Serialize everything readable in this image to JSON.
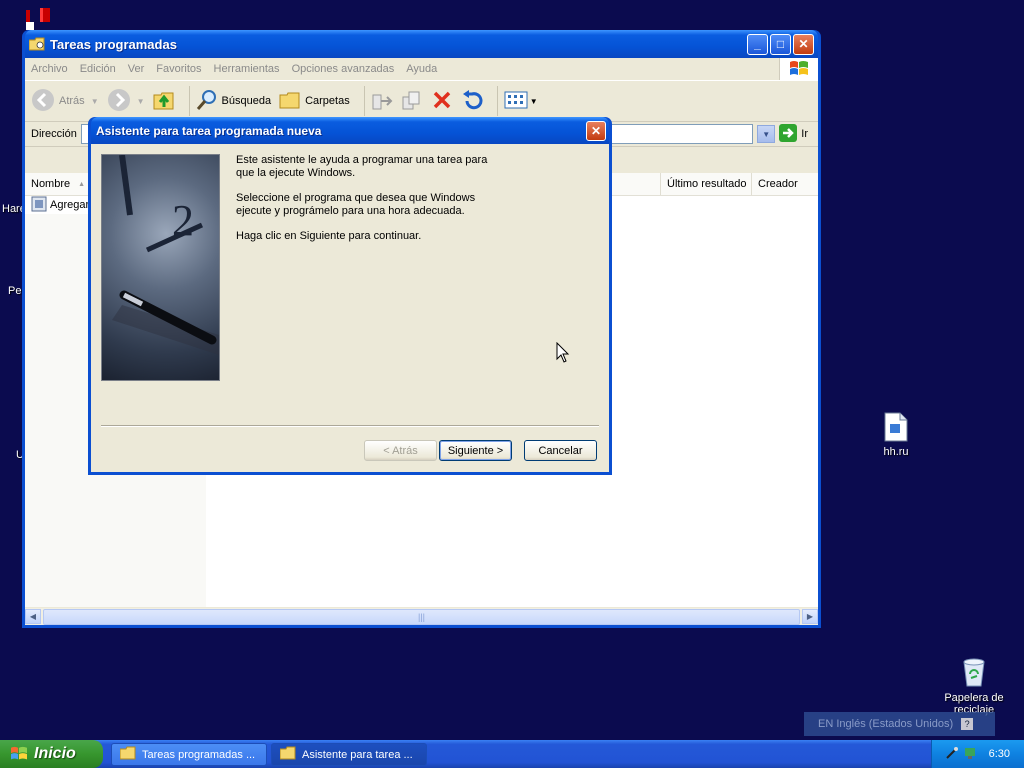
{
  "desktop": {
    "partial_labels": [
      "Hare",
      "Per",
      "U"
    ],
    "icons": [
      {
        "label": "hh.ru",
        "icon": "text-file-icon"
      },
      {
        "label": "Papelera de reciclaje",
        "icon": "recycle-bin-icon"
      }
    ]
  },
  "explorer": {
    "title": "Tareas programadas",
    "menu": [
      "Archivo",
      "Edición",
      "Ver",
      "Favoritos",
      "Herramientas",
      "Opciones avanzadas",
      "Ayuda"
    ],
    "toolbar": {
      "back": "Atrás",
      "search": "Búsqueda",
      "folders": "Carpetas"
    },
    "address_label": "Dirección",
    "go_label": "Ir",
    "columns": [
      "Nombre",
      "Último resultado",
      "Creador"
    ],
    "rows": [
      "Agregar"
    ]
  },
  "wizard": {
    "title": "Asistente para tarea programada nueva",
    "paragraphs": [
      "Este asistente le ayuda a programar una tarea para que la ejecute Windows.",
      "Seleccione el programa que desea que Windows ejecute y prográmelo para una hora adecuada.",
      "Haga clic en Siguiente para continuar."
    ],
    "buttons": {
      "back": "< Atrás",
      "next": "Siguiente >",
      "cancel": "Cancelar"
    }
  },
  "taskbar": {
    "start": "Inicio",
    "tasks": [
      "Tareas programadas ...",
      "Asistente para tarea ..."
    ],
    "clock": "6:30",
    "language": "EN Inglés (Estados Unidos)"
  },
  "colors": {
    "desktop": "#0b0b4f",
    "title_blue": "#0553d6",
    "start_green": "#37962e",
    "close_red": "#c23b10"
  }
}
